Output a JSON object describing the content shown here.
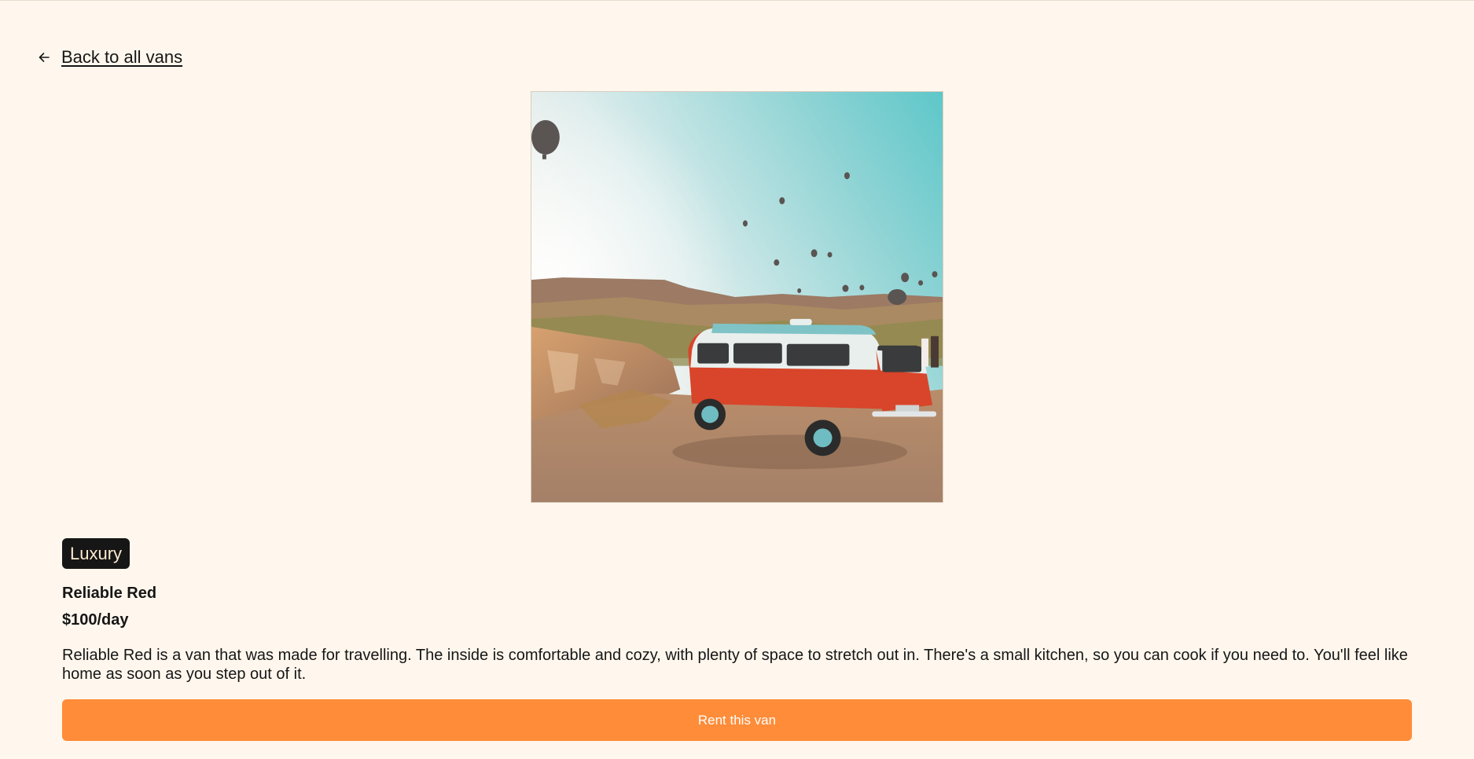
{
  "navigation": {
    "back_label": "Back to all vans",
    "back_icon": "arrow-left-icon"
  },
  "hero_image": {
    "alt": "",
    "description_icon": "van-photo"
  },
  "van": {
    "type": "Luxury",
    "name": "Reliable Red",
    "price": "$100/day",
    "description": "Reliable Red is a van that was made for travelling. The inside is comfortable and cozy, with plenty of space to stretch out in. There's a small kitchen, so you can cook if you need to. You'll feel like home as soon as you step out of it."
  },
  "actions": {
    "rent_label": "Rent this van"
  },
  "colors": {
    "background": "#FFF7ED",
    "badge_bg": "#161616",
    "badge_text": "#FFEAD0",
    "accent": "#FF8C38"
  }
}
